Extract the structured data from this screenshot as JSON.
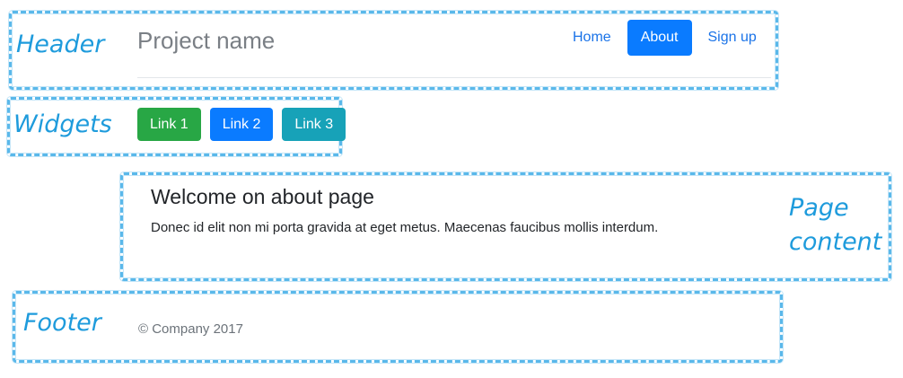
{
  "annotations": {
    "header": "Header",
    "widgets": "Widgets",
    "page_content": [
      "Page",
      "content"
    ],
    "footer": "Footer"
  },
  "header": {
    "project_name": "Project name",
    "nav": [
      {
        "label": "Home",
        "active": false
      },
      {
        "label": "About",
        "active": true
      },
      {
        "label": "Sign up",
        "active": false
      }
    ]
  },
  "widgets": {
    "buttons": [
      {
        "label": "Link 1",
        "color": "#28a745"
      },
      {
        "label": "Link 2",
        "color": "#0a7bff"
      },
      {
        "label": "Link 3",
        "color": "#17a2b8"
      }
    ]
  },
  "content": {
    "title": "Welcome on about page",
    "text": "Donec id elit non mi porta gravida at eget metus. Maecenas faucibus mollis interdum."
  },
  "footer": {
    "text": "© Company 2017"
  },
  "colors": {
    "annotation": "#1e9bdc",
    "accent": "#0a7bff"
  }
}
